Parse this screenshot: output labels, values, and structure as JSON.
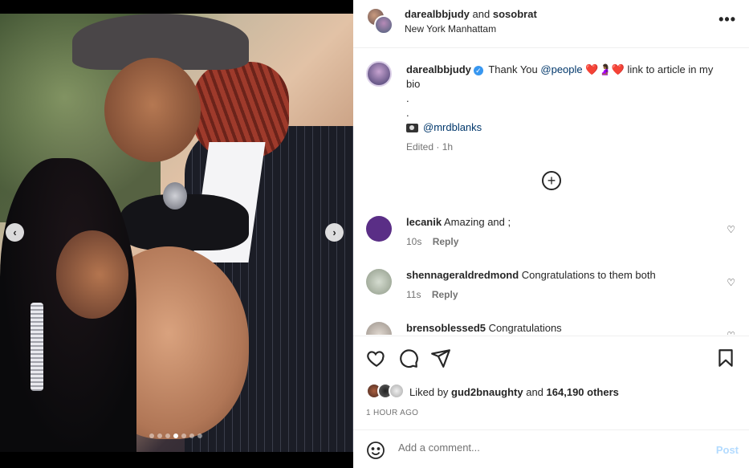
{
  "post": {
    "carousel": {
      "slide_count": 7,
      "active_index": 3
    },
    "header": {
      "user1": "darealbbjudy",
      "conjunction": "and",
      "user2": "sosobrat",
      "location": "New York Manhattam",
      "more_icon": "more-horizontal-icon"
    },
    "caption": {
      "username": "darealbbjudy",
      "text_before": "Thank You",
      "mention1": "@people",
      "hearts_left": "❤️",
      "emoji_mid": "🤰🏾",
      "hearts_right": "❤️",
      "text_after": "link to article in my bio",
      "dot1": ".",
      "dot2": ".",
      "camera_icon": "camera-icon",
      "mention2": "@mrdblanks",
      "edited": "Edited · 1h"
    },
    "comments": [
      {
        "username": "lecanik",
        "text": "Amazing and ;",
        "time": "10s",
        "reply": "Reply",
        "avatar_color": "#5a2e86"
      },
      {
        "username": "shennageraldredmond",
        "text": "Congratulations to them both",
        "time": "11s",
        "reply": "Reply",
        "avatar_color": "#a9b5a2"
      },
      {
        "username": "brensoblessed5",
        "text": "Congratulations",
        "time": "",
        "reply": "",
        "avatar_color": "#c8c0b8"
      }
    ],
    "likes": {
      "prefix": "Liked by",
      "user": "gud2bnaughty",
      "and": "and",
      "count_text": "164,190 others"
    },
    "timestamp": "1 HOUR AGO",
    "add_comment": {
      "placeholder": "Add a comment...",
      "post_label": "Post"
    },
    "colors": {
      "link": "#00376b",
      "muted": "#737373",
      "post_disabled": "#b3dbff",
      "verified": "#3897f0"
    }
  }
}
